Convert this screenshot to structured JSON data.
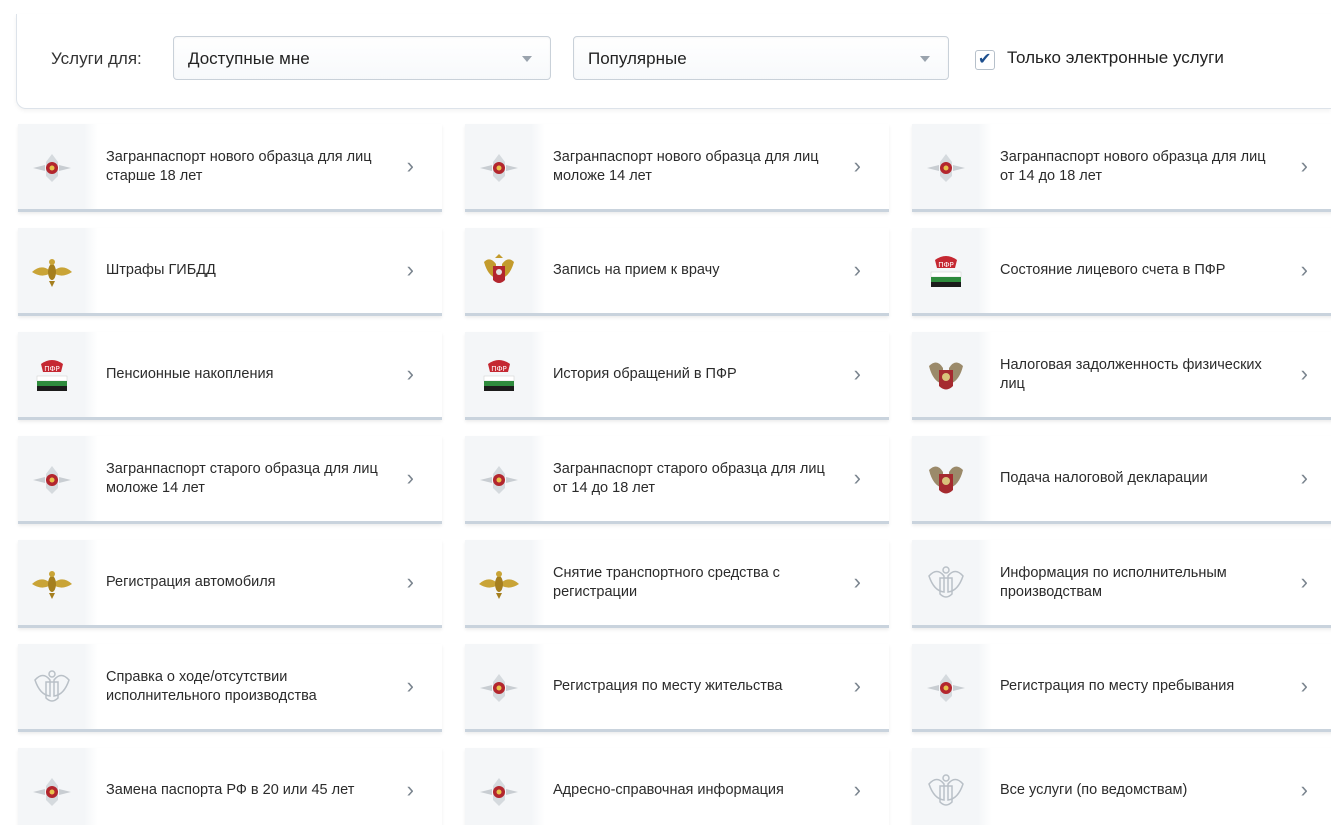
{
  "filters": {
    "label": "Услуги для:",
    "for_value": "Доступные мне",
    "sort_value": "Популярные",
    "electronic_only_label": "Только электронные услуги",
    "electronic_only_checked": true
  },
  "services": [
    {
      "title": "Загранпаспорт нового образца для лиц старше 18 лет",
      "icon": "fms-emblem-icon"
    },
    {
      "title": "Загранпаспорт нового образца для лиц моложе 14 лет",
      "icon": "fms-emblem-icon"
    },
    {
      "title": "Загранпаспорт нового образца для лиц от 14 до 18 лет",
      "icon": "fms-emblem-icon"
    },
    {
      "title": "Штрафы ГИБДД",
      "icon": "mvd-eagle-icon"
    },
    {
      "title": "Запись на прием к врачу",
      "icon": "coat-of-arms-icon"
    },
    {
      "title": "Состояние лицевого счета в ПФР",
      "icon": "pfr-logo-icon"
    },
    {
      "title": "Пенсионные накопления",
      "icon": "pfr-logo-icon"
    },
    {
      "title": "История обращений в ПФР",
      "icon": "pfr-logo-icon"
    },
    {
      "title": "Налоговая задолженность физических лиц",
      "icon": "fns-emblem-icon"
    },
    {
      "title": "Загранпаспорт старого образца для лиц моложе 14 лет",
      "icon": "fms-emblem-icon"
    },
    {
      "title": "Загранпаспорт старого образца для лиц от 14 до 18 лет",
      "icon": "fms-emblem-icon"
    },
    {
      "title": "Подача налоговой декларации",
      "icon": "fns-emblem-icon"
    },
    {
      "title": "Регистрация автомобиля",
      "icon": "mvd-eagle-icon"
    },
    {
      "title": "Снятие транспортного средства с регистрации",
      "icon": "mvd-eagle-icon"
    },
    {
      "title": "Информация по исполнительным производствам",
      "icon": "fssp-emblem-icon"
    },
    {
      "title": "Справка о ходе/отсутствии исполнительного производства",
      "icon": "fssp-emblem-icon"
    },
    {
      "title": "Регистрация по месту жительства",
      "icon": "fms-emblem-icon"
    },
    {
      "title": "Регистрация по месту пребывания",
      "icon": "fms-emblem-icon"
    },
    {
      "title": "Замена паспорта РФ в 20 или 45 лет",
      "icon": "fms-emblem-icon"
    },
    {
      "title": "Адресно-справочная информация",
      "icon": "fms-emblem-icon"
    },
    {
      "title": "Все услуги (по ведомствам)",
      "icon": "fssp-emblem-icon"
    }
  ],
  "colors": {
    "accent": "#1d4f8e",
    "card_border": "#c9d3dd"
  }
}
